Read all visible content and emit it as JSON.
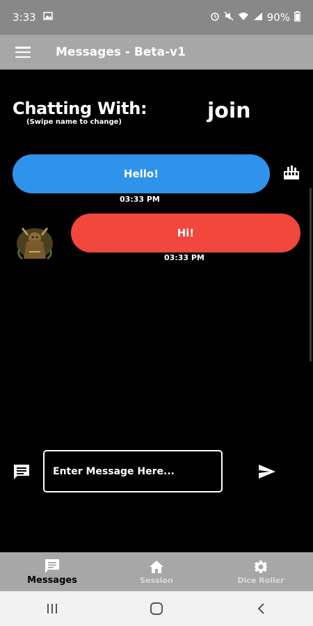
{
  "status_bar": {
    "time": "3:33",
    "battery": "90%",
    "icons": [
      "gallery-icon",
      "alarm-icon",
      "mute-icon",
      "wifi-icon",
      "signal-icon",
      "battery-icon"
    ]
  },
  "app_bar": {
    "title": "Messages - Beta-v1",
    "menu_icon": "hamburger-icon"
  },
  "chat": {
    "chatting_with_label": "Chatting With:",
    "swipe_hint": "(Swipe name to change)",
    "partner_name": "join",
    "messages": [
      {
        "text": "Hello!",
        "time": "03:33 PM",
        "direction": "outgoing",
        "color": "#2f93ec",
        "side_icon": "dice-icon"
      },
      {
        "text": "Hi!",
        "time": "03:33 PM",
        "direction": "incoming",
        "color": "#f2473c",
        "avatar": "character-avatar"
      }
    ]
  },
  "composer": {
    "placeholder": "Enter Message Here...",
    "value": "",
    "left_icon": "message-icon",
    "send_icon": "send-icon"
  },
  "bottom_nav": {
    "items": [
      {
        "label": "Messages",
        "icon": "message-icon",
        "active": true
      },
      {
        "label": "Session",
        "icon": "home-icon",
        "active": false
      },
      {
        "label": "Dice Roller",
        "icon": "gear-icon",
        "active": false
      }
    ]
  },
  "system_nav": {
    "buttons": [
      "recents-icon",
      "home-circle-icon",
      "back-icon"
    ]
  },
  "colors": {
    "status_bar": "#888888",
    "app_bar": "#a7a7a7",
    "background": "#000000",
    "outgoing_bubble": "#2f93ec",
    "incoming_bubble": "#f2473c"
  }
}
